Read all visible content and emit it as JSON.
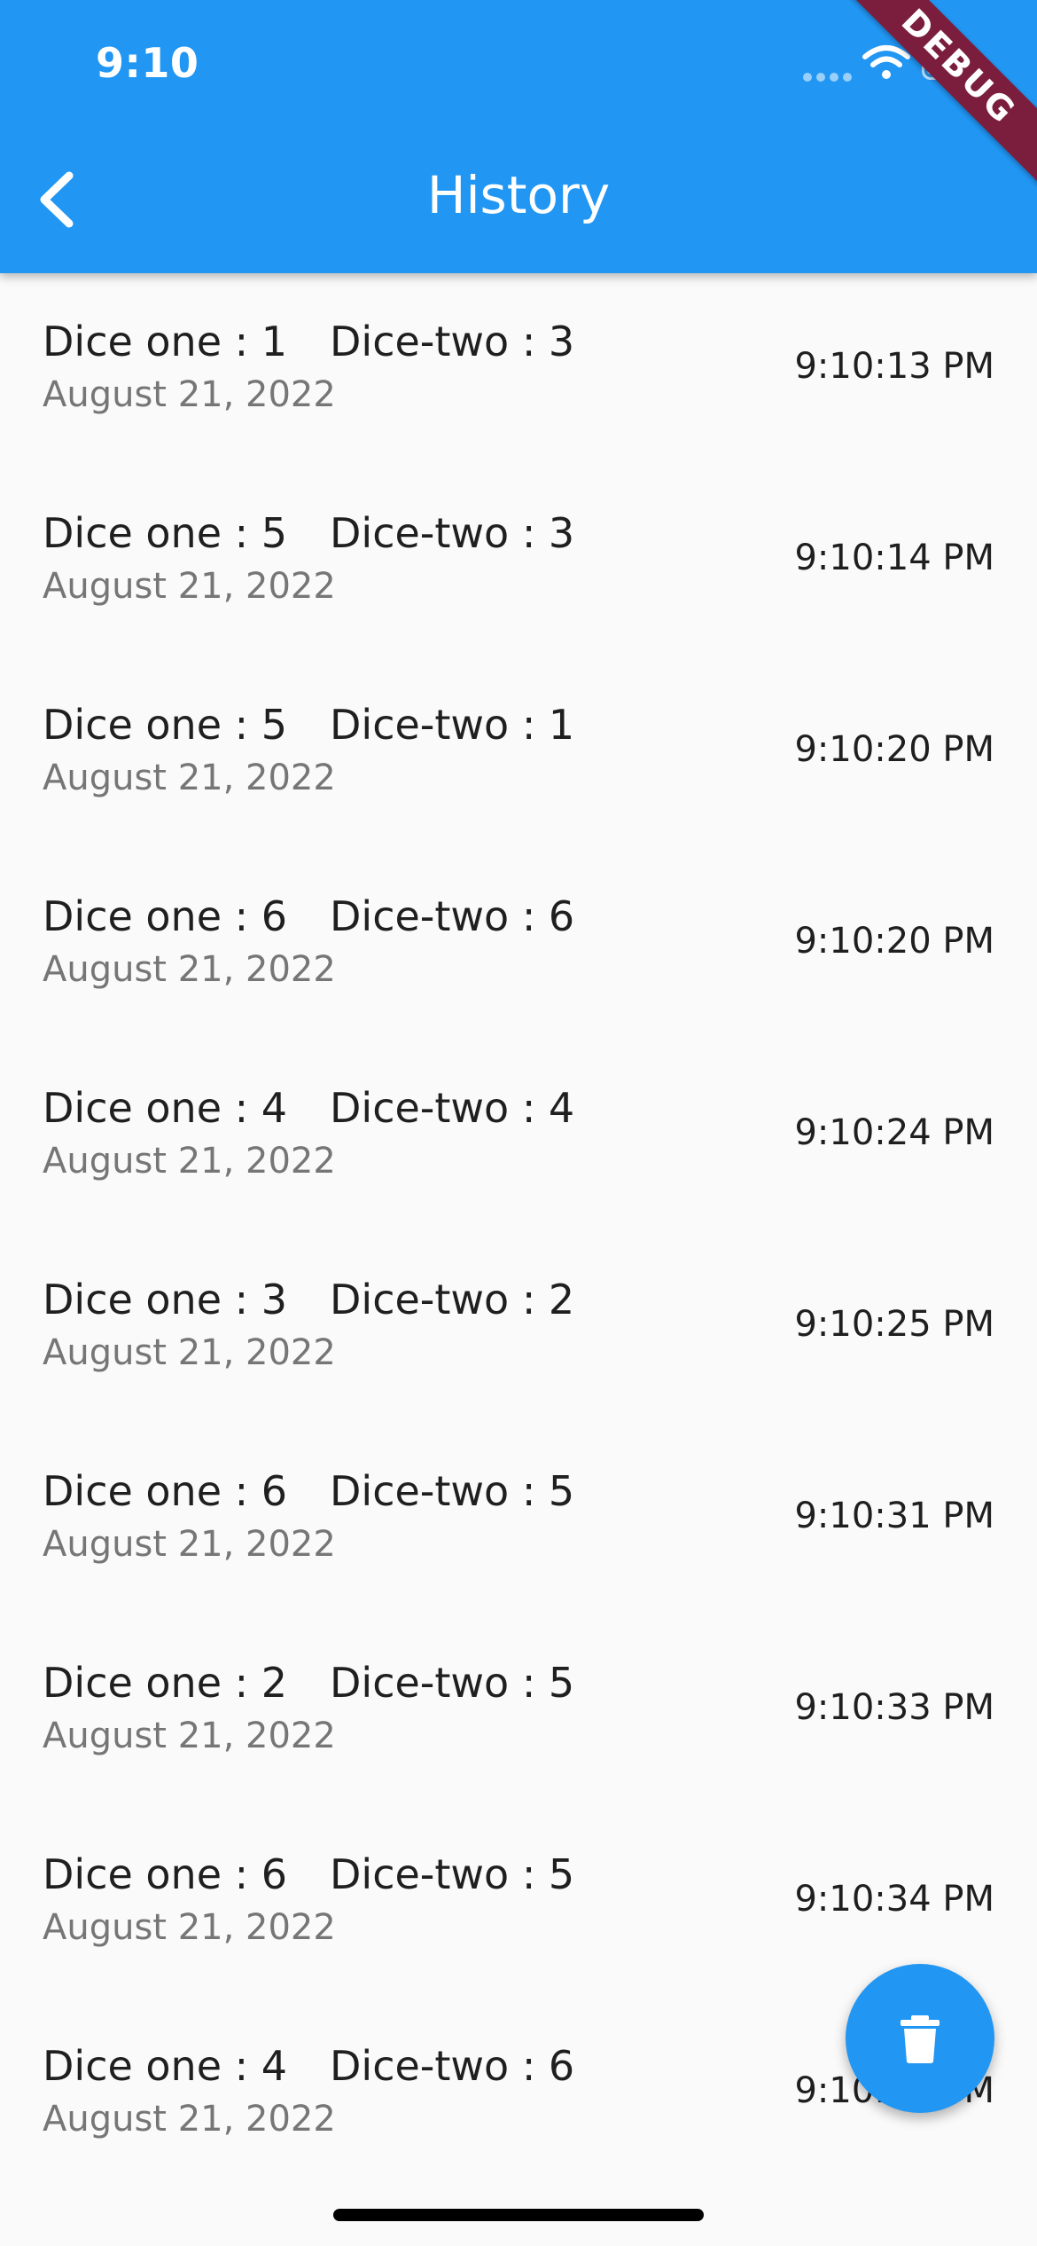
{
  "status_bar": {
    "time": "9:10"
  },
  "app_bar": {
    "title": "History",
    "debug_banner": "DEBUG"
  },
  "history": [
    {
      "dice_one": "Dice one : 1",
      "dice_two": "Dice-two : 3",
      "date": "August 21, 2022",
      "time": "9:10:13 PM"
    },
    {
      "dice_one": "Dice one : 5",
      "dice_two": "Dice-two : 3",
      "date": "August 21, 2022",
      "time": "9:10:14 PM"
    },
    {
      "dice_one": "Dice one : 5",
      "dice_two": "Dice-two : 1",
      "date": "August 21, 2022",
      "time": "9:10:20 PM"
    },
    {
      "dice_one": "Dice one : 6",
      "dice_two": "Dice-two : 6",
      "date": "August 21, 2022",
      "time": "9:10:20 PM"
    },
    {
      "dice_one": "Dice one : 4",
      "dice_two": "Dice-two : 4",
      "date": "August 21, 2022",
      "time": "9:10:24 PM"
    },
    {
      "dice_one": "Dice one : 3",
      "dice_two": "Dice-two : 2",
      "date": "August 21, 2022",
      "time": "9:10:25 PM"
    },
    {
      "dice_one": "Dice one : 6",
      "dice_two": "Dice-two : 5",
      "date": "August 21, 2022",
      "time": "9:10:31 PM"
    },
    {
      "dice_one": "Dice one : 2",
      "dice_two": "Dice-two : 5",
      "date": "August 21, 2022",
      "time": "9:10:33 PM"
    },
    {
      "dice_one": "Dice one : 6",
      "dice_two": "Dice-two : 5",
      "date": "August 21, 2022",
      "time": "9:10:34 PM"
    },
    {
      "dice_one": "Dice one : 4",
      "dice_two": "Dice-two : 6",
      "date": "August 21, 2022",
      "time": "9:10:35 PM"
    }
  ],
  "fab": {
    "icon": "trash-icon"
  },
  "colors": {
    "primary": "#2196f3",
    "debug_banner": "#7b1e3e",
    "background": "#fafafa",
    "secondary_text": "#767676"
  }
}
